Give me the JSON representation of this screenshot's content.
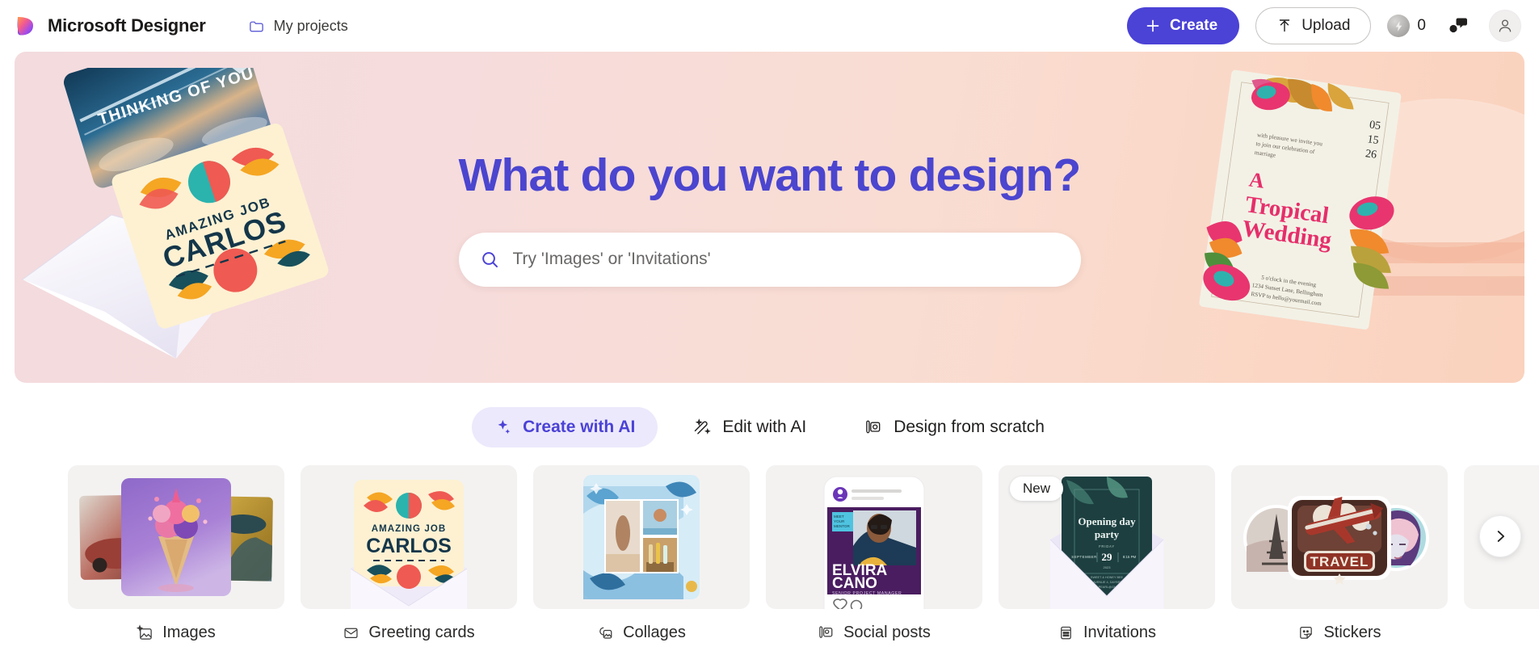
{
  "topbar": {
    "logo_icon": "designer-logo-icon",
    "brand_name": "Microsoft Designer",
    "my_projects": {
      "label": "My projects",
      "icon": "folder-icon"
    },
    "create_button": {
      "label": "Create",
      "icon": "plus-icon",
      "color": "#4b42d6"
    },
    "upload_button": {
      "label": "Upload",
      "icon": "upload-arrow-icon"
    },
    "credits": {
      "count": "0",
      "icon": "credit-bolt-icon"
    },
    "feedback_icon": "feedback-people-icon",
    "account_icon": "account-person-icon"
  },
  "hero": {
    "title": "What do you want to design?",
    "title_color": "#4b45cf",
    "gradient_from": "#f3dbde",
    "gradient_to": "#fad2bd",
    "search": {
      "placeholder": "Try 'Images' or 'Invitations'",
      "value": "",
      "icon": "search-icon",
      "icon_color": "#4b42d6"
    },
    "art_left": {
      "card_top_text": "THINKING OF YOU",
      "card_front_line1": "AMAZING JOB",
      "card_front_line2": "CARLOS"
    },
    "art_right": {
      "date_d1": "05",
      "date_d2": "15",
      "date_d3": "26",
      "intro": "with pleasure we invite you to join our celebration of marriage",
      "title_line1": "A",
      "title_line2": "Tropical",
      "title_line3": "Wedding",
      "footer_line1": "5 o'clock in the evening",
      "footer_line2": "1234 Sunset Lane, Bellingham",
      "footer_line3": "RSVP to hello@yourmail.com"
    }
  },
  "modes": [
    {
      "label": "Create with AI",
      "icon": "sparkle-icon",
      "active": true
    },
    {
      "label": "Edit with AI",
      "icon": "magic-wand-icon",
      "active": false
    },
    {
      "label": "Design from scratch",
      "icon": "pen-shapes-icon",
      "active": false
    }
  ],
  "carousel": {
    "next_button_icon": "chevron-right-icon",
    "cards": [
      {
        "label": "Images",
        "icon": "ai-image-icon",
        "badge": "",
        "art": "images"
      },
      {
        "label": "Greeting cards",
        "icon": "envelope-icon",
        "badge": "",
        "art": "greeting",
        "art_text": {
          "line1": "AMAZING JOB",
          "line2": "CARLOS"
        }
      },
      {
        "label": "Collages",
        "icon": "collage-icon",
        "badge": "",
        "art": "collage"
      },
      {
        "label": "Social posts",
        "icon": "social-post-icon",
        "badge": "",
        "art": "social",
        "art_text": {
          "tag": "MEET YOUR MENTOR",
          "name1": "ELVIRA",
          "name2": "CANO",
          "role": "SENIOR PROJECT MANAGER"
        }
      },
      {
        "label": "Invitations",
        "icon": "invitation-icon",
        "badge": "New",
        "art": "invitation",
        "art_text": {
          "title1": "Opening day",
          "title2": "party",
          "friday": "FRIDAY",
          "month": "SEPTEMBER",
          "day": "29",
          "time": "8:15 PM",
          "year": "2023",
          "details1": "SWEET & HONEY BEE",
          "details2": "123 AVENUE 4, DAYBREAK",
          "details3": "RSVP TO PEARL@GMAIL.COM"
        }
      },
      {
        "label": "Stickers",
        "icon": "sticker-icon",
        "badge": "",
        "art": "stickers",
        "art_text": {
          "travel": "TRAVEL"
        }
      }
    ]
  }
}
